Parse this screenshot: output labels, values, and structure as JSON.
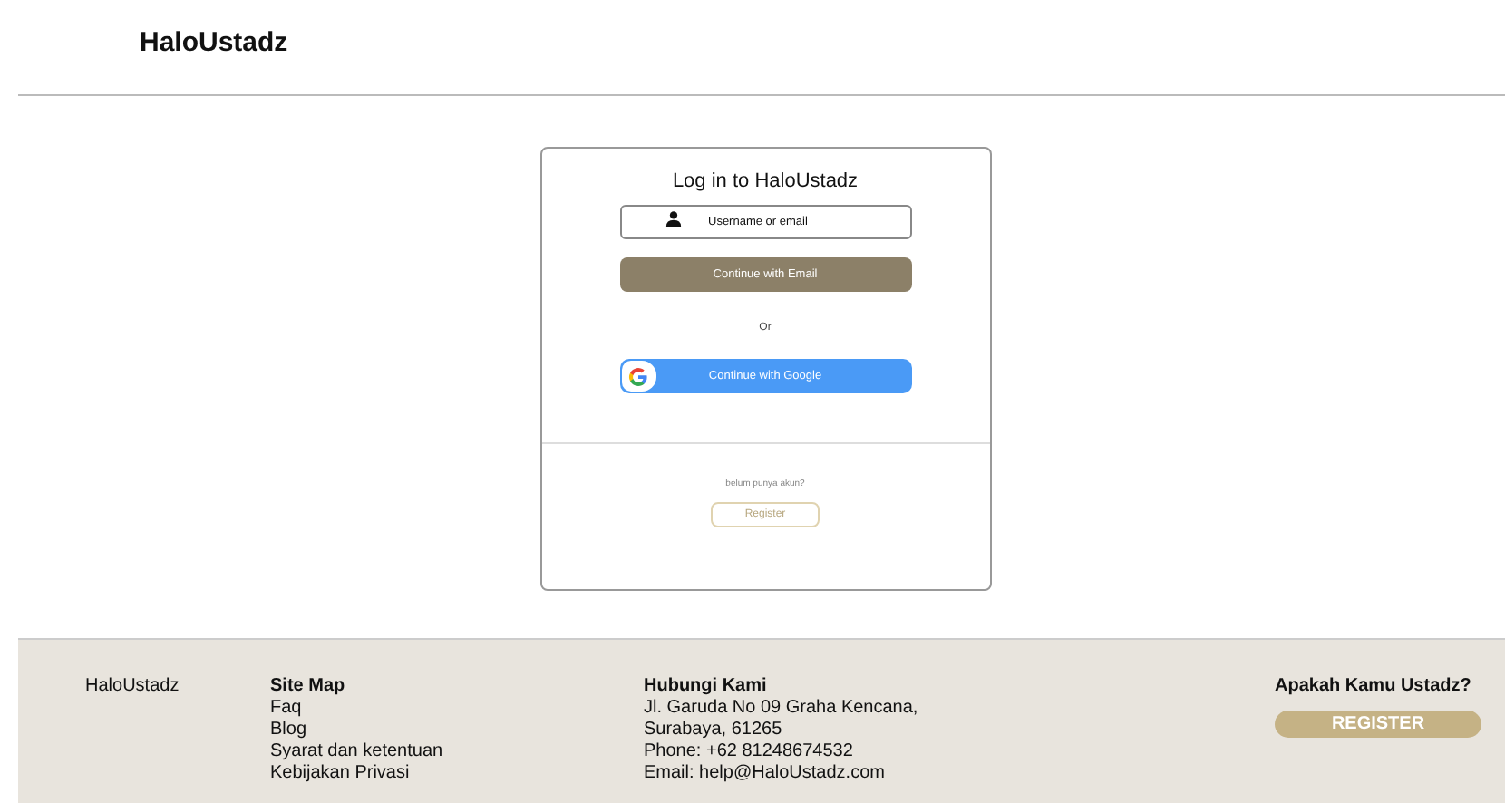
{
  "header": {
    "logo": "HaloUstadz"
  },
  "login": {
    "title": "Log in to HaloUstadz",
    "username": {
      "placeholder": "Username or email"
    },
    "email_button": "Continue with Email",
    "separator": "Or",
    "google_button": "Continue with Google",
    "register_prompt": "belum punya akun?",
    "register_button": "Register"
  },
  "footer": {
    "brand": "HaloUstadz",
    "site_map": {
      "heading": "Site Map",
      "links": [
        "Faq",
        "Blog",
        "Syarat dan ketentuan",
        "Kebijakan Privasi"
      ]
    },
    "contact": {
      "heading": "Hubungi Kami",
      "lines": [
        "Jl. Garuda No 09 Graha Kencana,",
        "Surabaya, 61265",
        "Phone: +62 81248674532",
        "Email: help@HaloUstadz.com"
      ]
    },
    "ustadz": {
      "heading": "Apakah Kamu Ustadz?",
      "button": "REGISTER"
    }
  }
}
